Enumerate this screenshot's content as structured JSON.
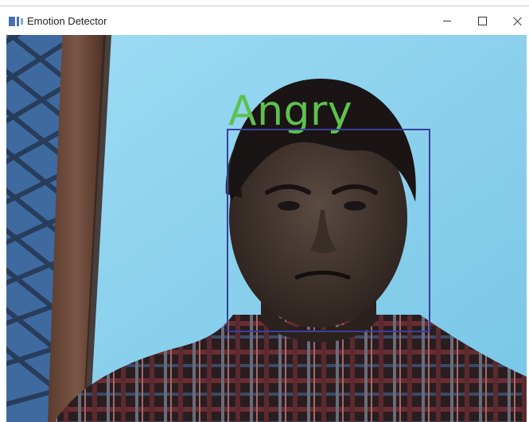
{
  "window": {
    "title": "Emotion Detector",
    "controls": {
      "minimize": "minimize-icon",
      "maximize": "maximize-icon",
      "close": "close-icon"
    }
  },
  "detection": {
    "emotion_label": "Angry",
    "label_color": "#5ec14f",
    "box_color": "#3b3f9e"
  },
  "colors": {
    "background_wall": "#8fd3ee",
    "door_frame": "#6b4b3c"
  }
}
